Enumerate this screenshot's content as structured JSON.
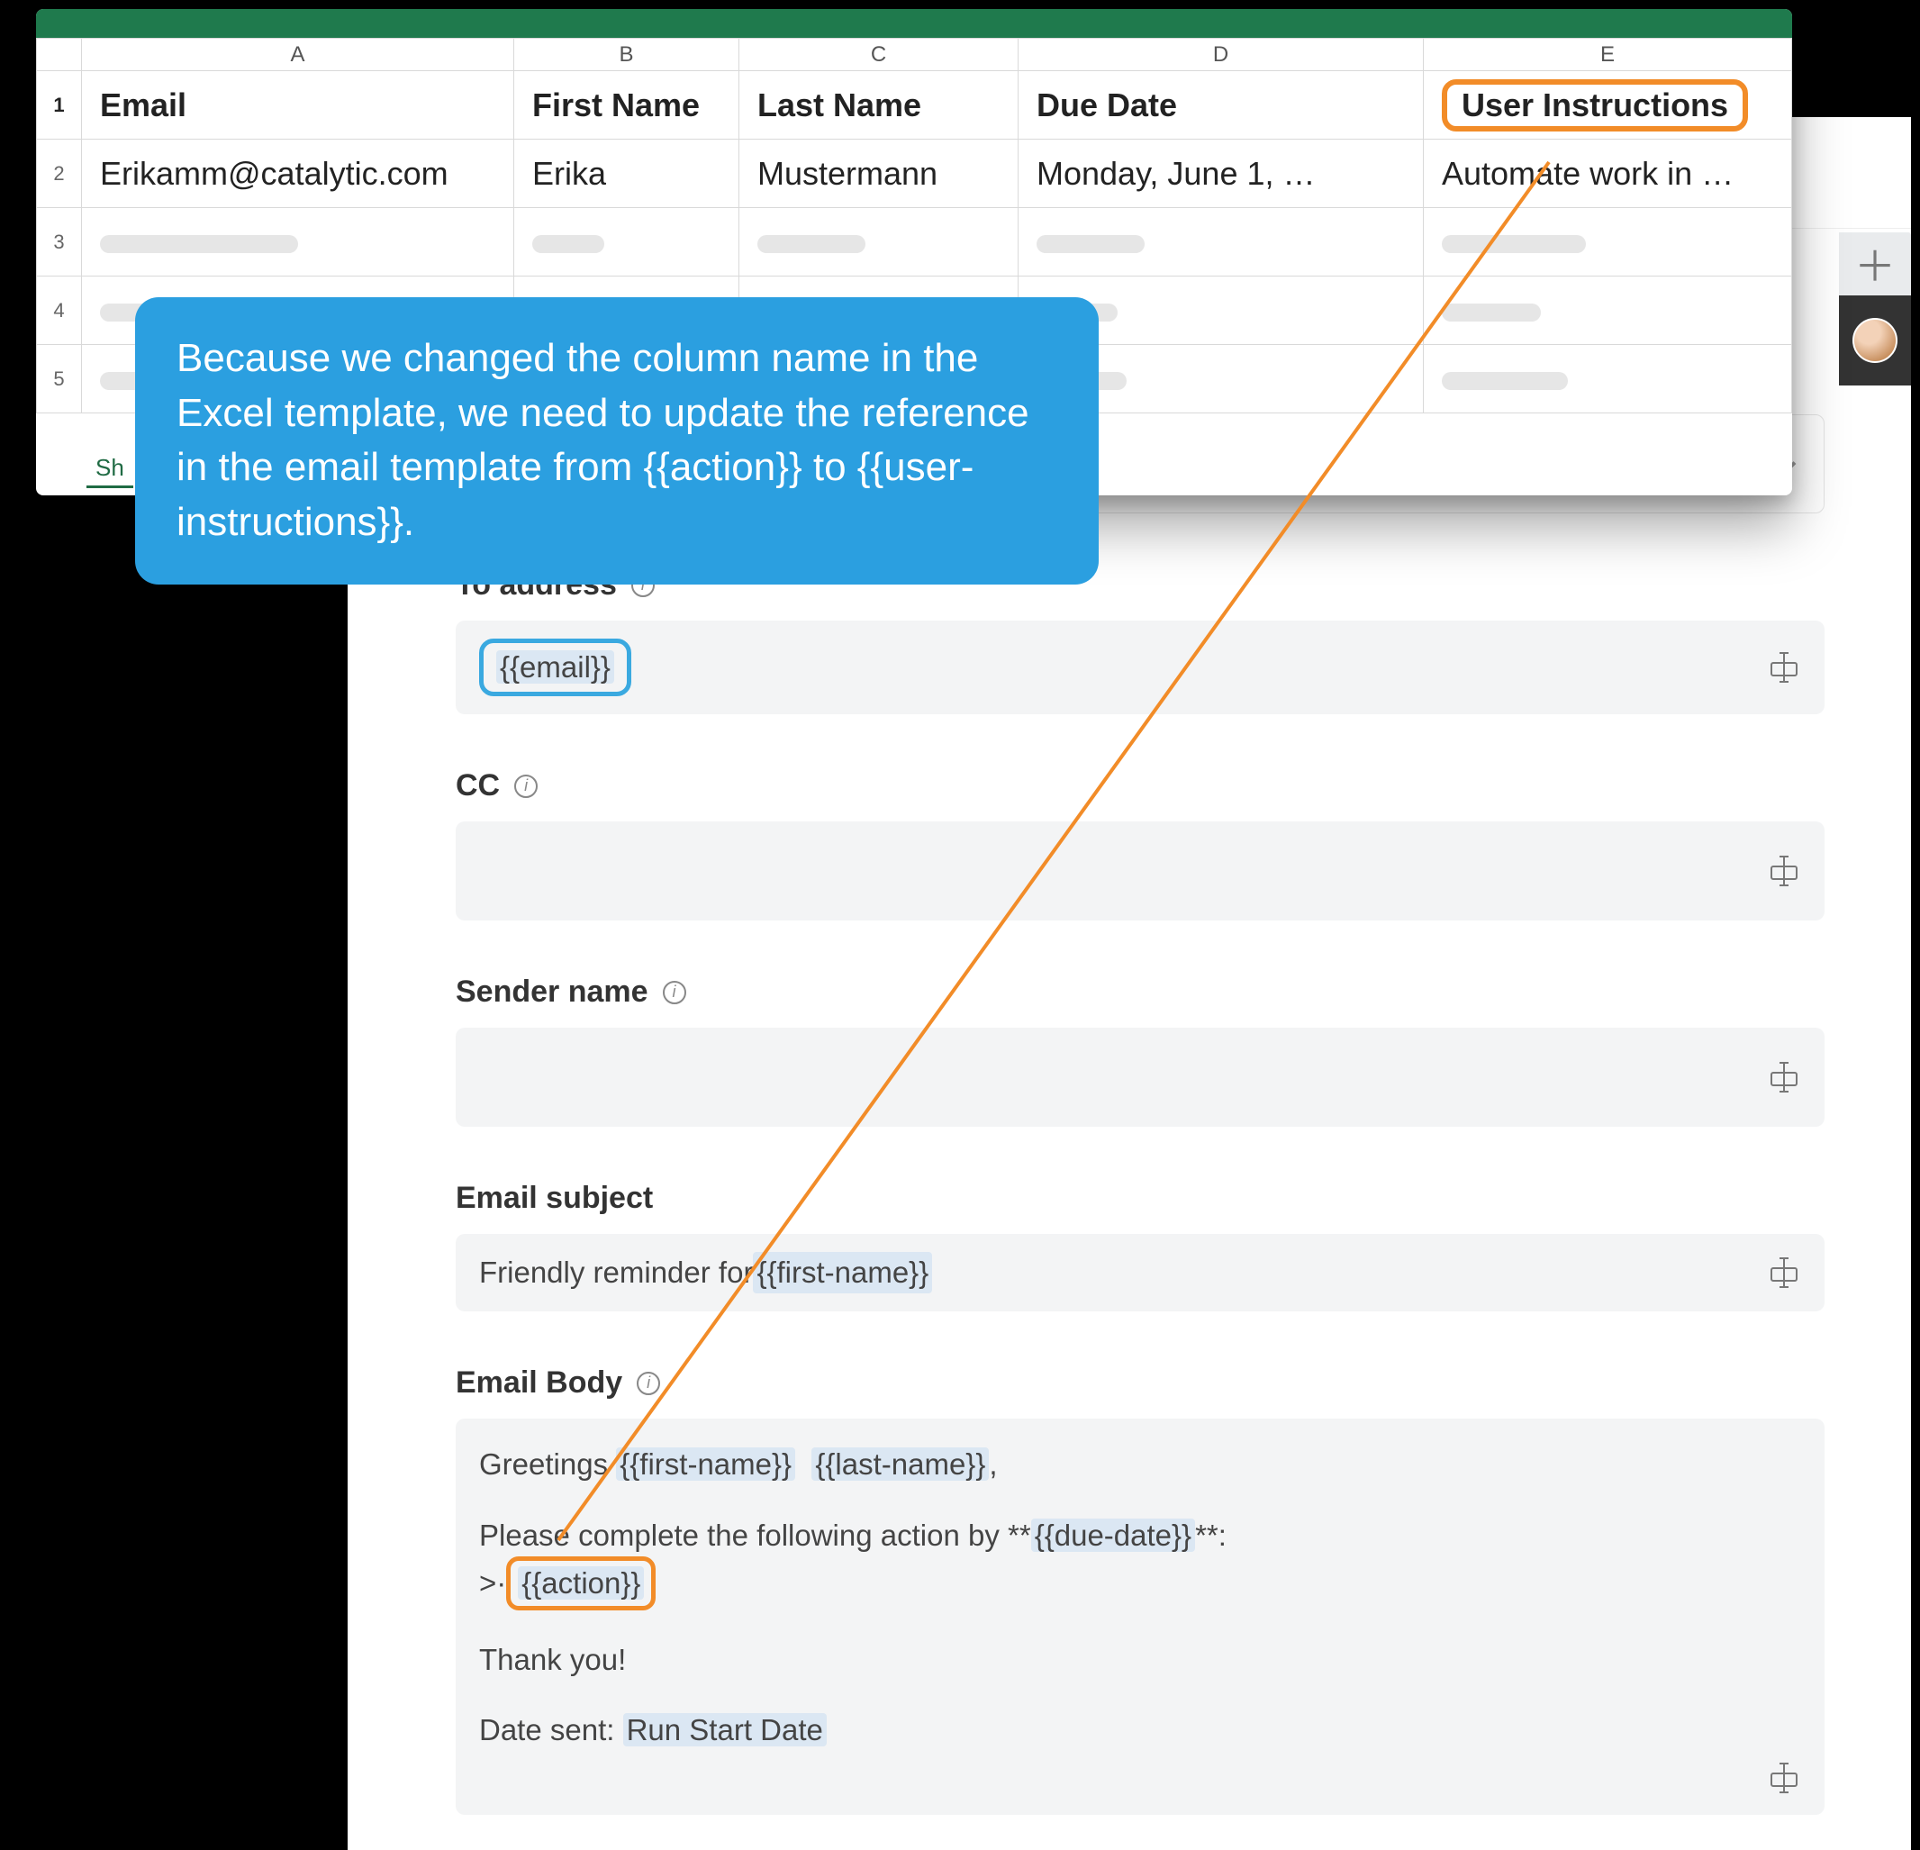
{
  "spreadsheet": {
    "columns": [
      "A",
      "B",
      "C",
      "D",
      "E"
    ],
    "headers": {
      "email": "Email",
      "first_name": "First Name",
      "last_name": "Last Name",
      "due_date": "Due Date",
      "user_instructions": "User Instructions"
    },
    "row2": {
      "email": "Erikamm@catalytic.com",
      "first_name": "Erika",
      "last_name": "Mustermann",
      "due_date": "Monday, June 1, …",
      "user_instructions": "Automate work in …"
    },
    "sheet_tab": "Sh"
  },
  "callout": {
    "text": "Because we changed the column name in the Excel template, we need to update the reference in the email template from {{action}} to  {{user-instructions}}."
  },
  "form": {
    "to_address": {
      "label": "To address",
      "value_token": "{{email}}"
    },
    "cc": {
      "label": "CC"
    },
    "sender_name": {
      "label": "Sender name"
    },
    "subject": {
      "label": "Email subject",
      "prefix": "Friendly reminder for ",
      "token": "{{first-name}}"
    },
    "body": {
      "label": "Email Body",
      "greeting_prefix": "Greetings ",
      "first_name_token": "{{first-name}}",
      "last_name_token": "{{last-name}}",
      "greeting_suffix": ",",
      "line2_prefix": "Please complete the following action by **",
      "due_date_token": "{{due-date}}",
      "line2_suffix": "**:",
      "bullet_prefix": ">·",
      "action_token": "{{action}}",
      "thanks": "Thank you!",
      "date_sent_prefix": "Date sent: ",
      "date_sent_value": "Run Start Date"
    }
  },
  "tabstrip": {
    "plus": "＋"
  }
}
